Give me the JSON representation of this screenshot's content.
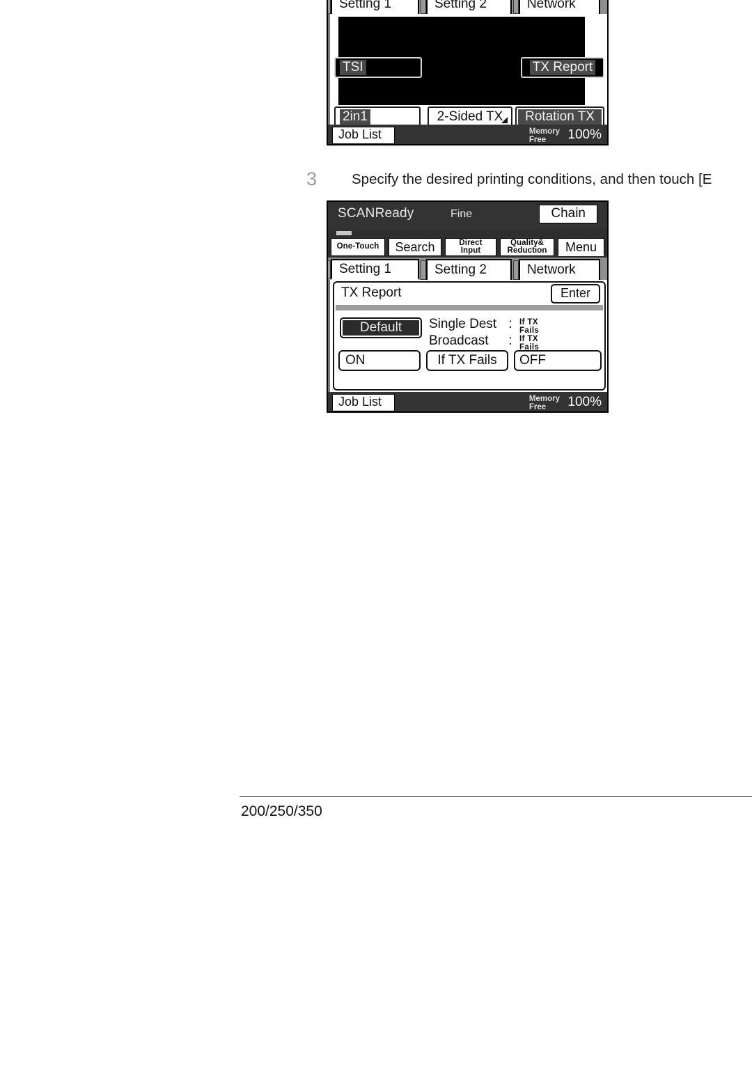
{
  "page": {
    "footer_label": "200/250/350"
  },
  "step": {
    "number": "3",
    "instruction": "Specify the desired printing conditions, and then touch [E"
  },
  "panel1": {
    "tabs": [
      {
        "label": "Setting 1"
      },
      {
        "label": "Setting 2"
      },
      {
        "label": "Network"
      }
    ],
    "buttons": {
      "tsi": "TSI",
      "tx_report": "TX Report",
      "two_in_one": "2in1",
      "two_sided_tx": "2-Sided TX",
      "rotation_tx": "Rotation TX"
    },
    "bottom": {
      "job_list": "Job List",
      "memory_line1": "Memory",
      "memory_line2": "Free",
      "memory_value": "100%"
    }
  },
  "panel2": {
    "header": {
      "status": "SCANReady",
      "resolution": "Fine",
      "chain": "Chain"
    },
    "keys": [
      {
        "label": "One-Touch",
        "style": "small"
      },
      {
        "label": "Search",
        "style": "normal"
      },
      {
        "label_line1": "Direct",
        "label_line2": "Input",
        "style": "small-two"
      },
      {
        "label_line1": "Quality&",
        "label_line2": "Reduction",
        "style": "small-two"
      },
      {
        "label": "Menu",
        "style": "normal"
      }
    ],
    "tabs": [
      {
        "label": "Setting 1"
      },
      {
        "label": "Setting 2"
      },
      {
        "label": "Network"
      }
    ],
    "content": {
      "title": "TX Report",
      "enter": "Enter",
      "default_button": "Default",
      "rows": [
        {
          "name": "Single Dest",
          "colon": ":",
          "value_line1": "If TX",
          "value_line2": "Fails"
        },
        {
          "name": "Broadcast",
          "colon": ":",
          "value_line1": "If TX",
          "value_line2": "Fails"
        }
      ],
      "options": [
        {
          "label": "ON"
        },
        {
          "label": "If TX Fails"
        },
        {
          "label": "OFF"
        }
      ]
    },
    "bottom": {
      "job_list": "Job List",
      "memory_line1": "Memory",
      "memory_line2": "Free",
      "memory_value": "100%"
    }
  }
}
